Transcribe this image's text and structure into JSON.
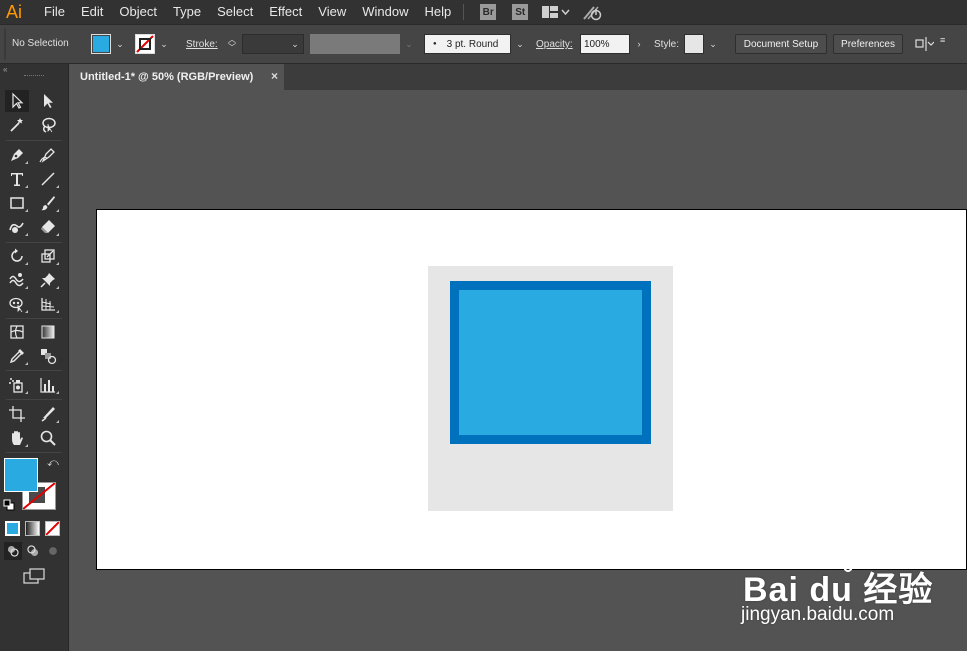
{
  "app": {
    "logo_text": "Ai"
  },
  "menu": {
    "items": [
      "File",
      "Edit",
      "Object",
      "Type",
      "Select",
      "Effect",
      "View",
      "Window",
      "Help"
    ],
    "bridge_badge": "Br",
    "stock_badge": "St"
  },
  "control_bar": {
    "selection_status": "No Selection",
    "stroke_label": "Stroke:",
    "brush_value": "3 pt. Round",
    "opacity_label": "Opacity:",
    "opacity_value": "100%",
    "style_label": "Style:",
    "document_setup_label": "Document Setup",
    "preferences_label": "Preferences",
    "fill_color": "#29abe2",
    "style_swatch_color": "#e6e6e6"
  },
  "document": {
    "tab_title": "Untitled-1* @ 50% (RGB/Preview)",
    "close_symbol": "×"
  },
  "artwork": {
    "background_square_color": "#e6e6e6",
    "rect_fill_color": "#29abe2",
    "rect_stroke_color": "#0071bc"
  },
  "toolbar": {
    "fill_color": "#29abe2"
  },
  "watermark": {
    "logo_text": "Bai du 经验",
    "url_text": "jingyan.baidu.com"
  }
}
